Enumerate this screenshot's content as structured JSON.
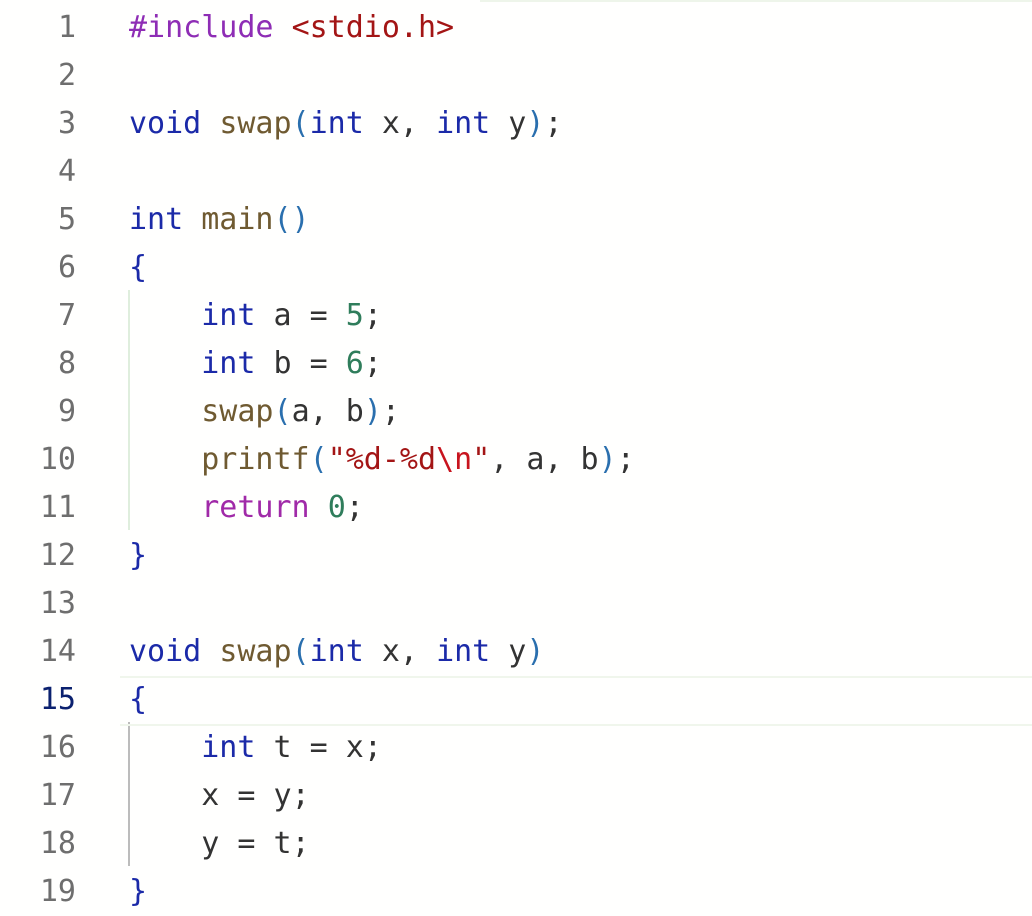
{
  "editor": {
    "colors": {
      "background": "#fffffe",
      "line_number": "#6e6e6e",
      "active_line_number": "#0b216f",
      "keyword": "#1b2aa8",
      "function": "#6f5a31",
      "number": "#2f7d5b",
      "preprocessor": "#8e2db5",
      "string": "#a31515",
      "control": "#a02aa8"
    },
    "active_line": 15,
    "lines": [
      {
        "num": "1",
        "tokens": [
          {
            "t": "#include",
            "k": "pre"
          },
          {
            "t": " ",
            "k": "id"
          },
          {
            "t": "<stdio.h>",
            "k": "str"
          }
        ]
      },
      {
        "num": "2",
        "tokens": []
      },
      {
        "num": "3",
        "tokens": [
          {
            "t": "void",
            "k": "kw"
          },
          {
            "t": " ",
            "k": "id"
          },
          {
            "t": "swap",
            "k": "fn"
          },
          {
            "t": "(",
            "k": "paren"
          },
          {
            "t": "int",
            "k": "kw"
          },
          {
            "t": " x, ",
            "k": "id"
          },
          {
            "t": "int",
            "k": "kw"
          },
          {
            "t": " y",
            "k": "id"
          },
          {
            "t": ")",
            "k": "paren"
          },
          {
            "t": ";",
            "k": "punc"
          }
        ]
      },
      {
        "num": "4",
        "tokens": []
      },
      {
        "num": "5",
        "tokens": [
          {
            "t": "int",
            "k": "kw"
          },
          {
            "t": " ",
            "k": "id"
          },
          {
            "t": "main",
            "k": "fn"
          },
          {
            "t": "()",
            "k": "paren"
          }
        ]
      },
      {
        "num": "6",
        "tokens": [
          {
            "t": "{",
            "k": "brace"
          }
        ]
      },
      {
        "num": "7",
        "tokens": [
          {
            "t": "    ",
            "k": "id"
          },
          {
            "t": "int",
            "k": "kw"
          },
          {
            "t": " a = ",
            "k": "id"
          },
          {
            "t": "5",
            "k": "num"
          },
          {
            "t": ";",
            "k": "punc"
          }
        ]
      },
      {
        "num": "8",
        "tokens": [
          {
            "t": "    ",
            "k": "id"
          },
          {
            "t": "int",
            "k": "kw"
          },
          {
            "t": " b = ",
            "k": "id"
          },
          {
            "t": "6",
            "k": "num"
          },
          {
            "t": ";",
            "k": "punc"
          }
        ]
      },
      {
        "num": "9",
        "tokens": [
          {
            "t": "    ",
            "k": "id"
          },
          {
            "t": "swap",
            "k": "fn"
          },
          {
            "t": "(",
            "k": "paren"
          },
          {
            "t": "a, b",
            "k": "id"
          },
          {
            "t": ")",
            "k": "paren"
          },
          {
            "t": ";",
            "k": "punc"
          }
        ]
      },
      {
        "num": "10",
        "tokens": [
          {
            "t": "    ",
            "k": "id"
          },
          {
            "t": "printf",
            "k": "fn"
          },
          {
            "t": "(",
            "k": "paren"
          },
          {
            "t": "\"%d-%d",
            "k": "str"
          },
          {
            "t": "\\n",
            "k": "esc"
          },
          {
            "t": "\"",
            "k": "str"
          },
          {
            "t": ", a, b",
            "k": "id"
          },
          {
            "t": ")",
            "k": "paren"
          },
          {
            "t": ";",
            "k": "punc"
          }
        ]
      },
      {
        "num": "11",
        "tokens": [
          {
            "t": "    ",
            "k": "id"
          },
          {
            "t": "return",
            "k": "ctrl"
          },
          {
            "t": " ",
            "k": "id"
          },
          {
            "t": "0",
            "k": "num"
          },
          {
            "t": ";",
            "k": "punc"
          }
        ]
      },
      {
        "num": "12",
        "tokens": [
          {
            "t": "}",
            "k": "brace"
          }
        ]
      },
      {
        "num": "13",
        "tokens": []
      },
      {
        "num": "14",
        "tokens": [
          {
            "t": "void",
            "k": "kw"
          },
          {
            "t": " ",
            "k": "id"
          },
          {
            "t": "swap",
            "k": "fn"
          },
          {
            "t": "(",
            "k": "paren"
          },
          {
            "t": "int",
            "k": "kw"
          },
          {
            "t": " x, ",
            "k": "id"
          },
          {
            "t": "int",
            "k": "kw"
          },
          {
            "t": " y",
            "k": "id"
          },
          {
            "t": ")",
            "k": "paren"
          }
        ]
      },
      {
        "num": "15",
        "tokens": [
          {
            "t": "{",
            "k": "brace"
          }
        ]
      },
      {
        "num": "16",
        "tokens": [
          {
            "t": "    ",
            "k": "id"
          },
          {
            "t": "int",
            "k": "kw"
          },
          {
            "t": " t = x",
            "k": "id"
          },
          {
            "t": ";",
            "k": "punc"
          }
        ]
      },
      {
        "num": "17",
        "tokens": [
          {
            "t": "    ",
            "k": "id"
          },
          {
            "t": "x = y",
            "k": "id"
          },
          {
            "t": ";",
            "k": "punc"
          }
        ]
      },
      {
        "num": "18",
        "tokens": [
          {
            "t": "    ",
            "k": "id"
          },
          {
            "t": "y = t",
            "k": "id"
          },
          {
            "t": ";",
            "k": "punc"
          }
        ]
      },
      {
        "num": "19",
        "tokens": [
          {
            "t": "}",
            "k": "brace"
          }
        ]
      }
    ]
  }
}
